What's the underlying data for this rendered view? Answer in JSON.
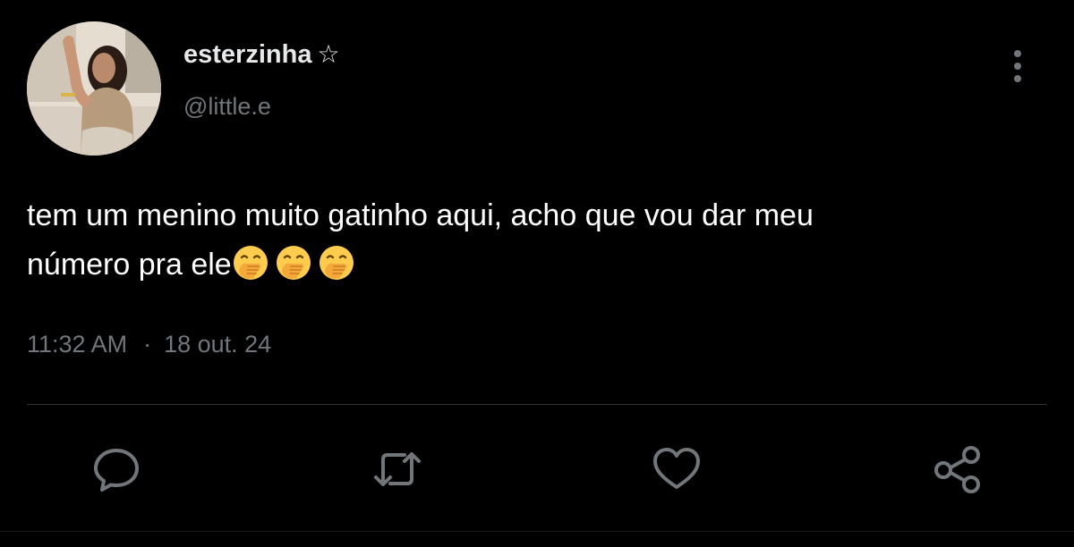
{
  "tweet": {
    "author": {
      "display_name": "esterzinha",
      "badge": "☆",
      "handle": "@little.e"
    },
    "text_line1": "tem um menino muito gatinho aqui, acho que vou dar meu",
    "text_line2": "número pra ele",
    "emojis": [
      "hand-over-mouth-emoji",
      "hand-over-mouth-emoji",
      "hand-over-mouth-emoji"
    ],
    "time": "11:32 AM",
    "separator": "·",
    "date": "18 out. 24"
  },
  "actions": {
    "icons": [
      "reply-icon",
      "retweet-icon",
      "like-icon",
      "share-icon",
      "more-vertical-icon"
    ]
  },
  "colors": {
    "background": "#000000",
    "text": "#ffffff",
    "secondary_text": "#71767b",
    "divider": "#2f3336",
    "icon": "#71767b"
  }
}
